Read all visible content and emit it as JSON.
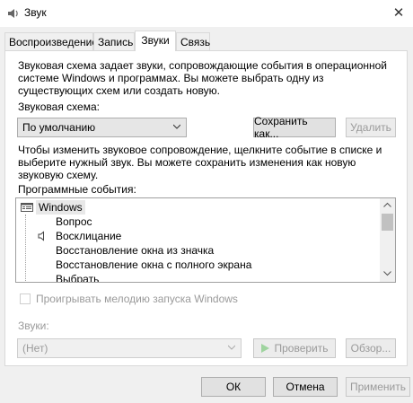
{
  "window": {
    "title": "Звук",
    "close_glyph": "✕"
  },
  "tabs": [
    {
      "label": "Воспроизведение",
      "active": false
    },
    {
      "label": "Запись",
      "active": false
    },
    {
      "label": "Звуки",
      "active": true
    },
    {
      "label": "Связь",
      "active": false
    }
  ],
  "sounds_tab": {
    "description": "Звуковая схема задает звуки, сопровождающие события в операционной системе Windows и программах. Вы можете выбрать одну из существующих схем или создать новую.",
    "scheme_label": "Звуковая схема:",
    "scheme_value": "По умолчанию",
    "save_as_label": "Сохранить как...",
    "delete_label": "Удалить",
    "instructions": "Чтобы изменить звуковое сопровождение, щелкните событие в списке и выберите нужный звук. Вы можете сохранить изменения как новую звуковую схему.",
    "events_label": "Программные события:",
    "events": [
      {
        "label": "Windows",
        "level": 0,
        "icon": "group-icon"
      },
      {
        "label": "Вопрос",
        "level": 1,
        "icon": ""
      },
      {
        "label": "Восклицание",
        "level": 1,
        "icon": "speaker-icon"
      },
      {
        "label": "Восстановление окна из значка",
        "level": 1,
        "icon": ""
      },
      {
        "label": "Восстановление окна с полного экрана",
        "level": 1,
        "icon": ""
      },
      {
        "label": "Выбрать",
        "level": 1,
        "icon": ""
      }
    ],
    "startup_checkbox_label": "Проигрывать мелодию запуска Windows",
    "startup_checked": false,
    "sounds_label": "Звуки:",
    "sound_value": "(Нет)",
    "test_label": "Проверить",
    "browse_label": "Обзор..."
  },
  "footer": {
    "ok": "ОК",
    "cancel": "Отмена",
    "apply": "Применить"
  },
  "colors": {
    "accent": "#0078d7",
    "disabled_text": "#9a9a9a",
    "panel_bg": "#ffffff",
    "window_bg": "#f0f0f0"
  }
}
